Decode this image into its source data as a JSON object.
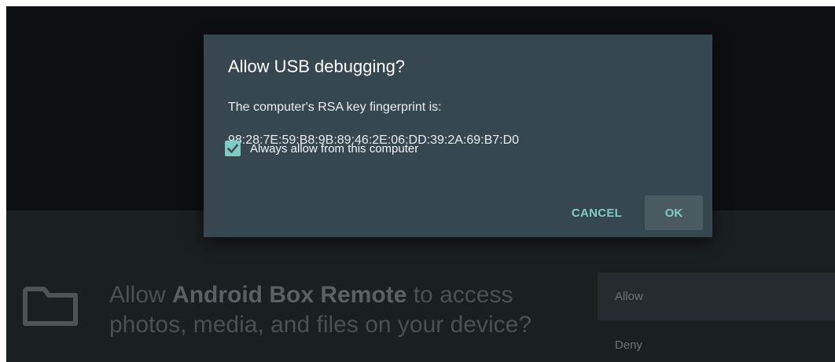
{
  "dialog": {
    "title": "Allow USB debugging?",
    "message_line1": "The computer's RSA key fingerprint is:",
    "fingerprint": "98:28:7E:59:B8:9B:89:46:2E:06:DD:39:2A:69:B7:D0",
    "checkbox_label": "Always allow from this computer",
    "checkbox_checked": true,
    "cancel_label": "CANCEL",
    "ok_label": "OK",
    "accent_color": "#80cbc4",
    "background_color": "#37474f"
  },
  "permission": {
    "icon": "folder-icon",
    "text_before": "Allow ",
    "app_name": "Android Box Remote",
    "text_after": " to access photos, media, and files on your device?",
    "options": [
      {
        "label": "Allow"
      },
      {
        "label": "Deny"
      }
    ]
  }
}
